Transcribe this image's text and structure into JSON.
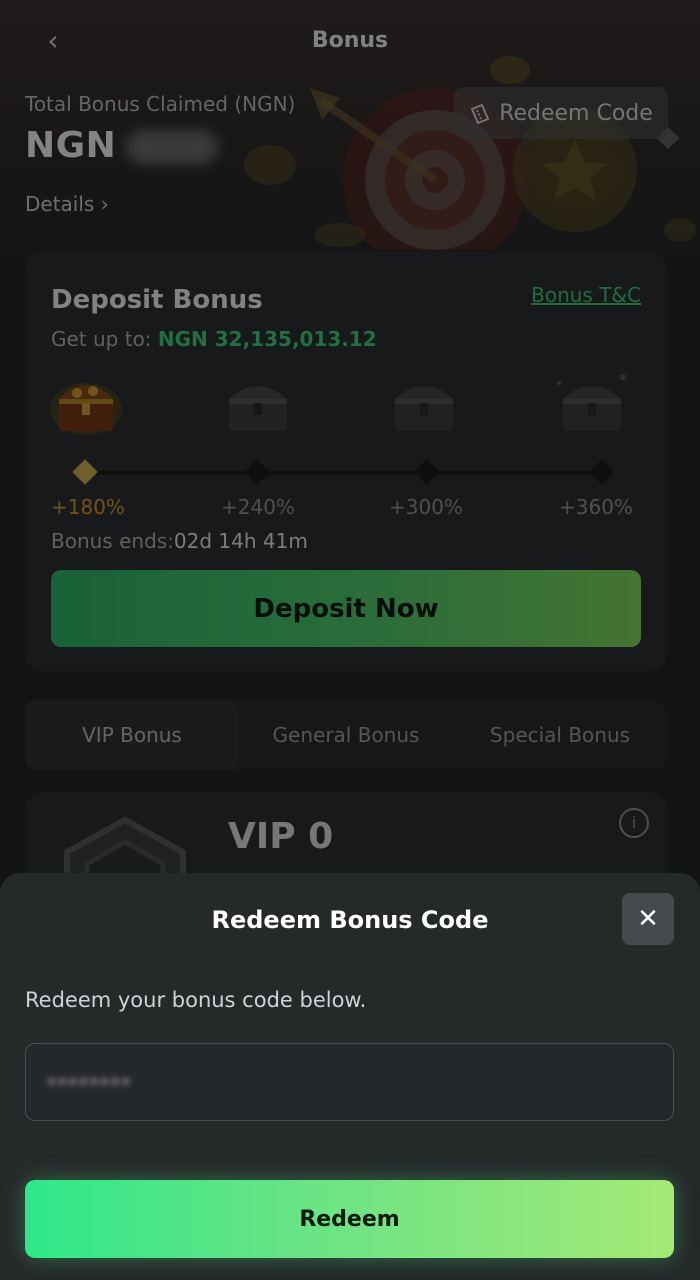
{
  "header": {
    "title": "Bonus",
    "back_icon": "chevron-left-icon"
  },
  "summary": {
    "total_label": "Total Bonus Claimed (NGN)",
    "total_currency": "NGN",
    "details_label": "Details",
    "redeem_code_label": "Redeem Code"
  },
  "deposit_bonus": {
    "title": "Deposit Bonus",
    "tc_label": "Bonus T&C",
    "get_up_to_label": "Get up to:",
    "get_up_to_amount": "NGN 32,135,013.12",
    "tiers": [
      {
        "percent": "+180%",
        "active": true
      },
      {
        "percent": "+240%",
        "active": false
      },
      {
        "percent": "+300%",
        "active": false
      },
      {
        "percent": "+360%",
        "active": false
      }
    ],
    "ends_label": "Bonus ends:",
    "ends_value": "02d 14h 41m",
    "cta_label": "Deposit Now"
  },
  "tabs": [
    {
      "label": "VIP Bonus",
      "active": true
    },
    {
      "label": "General Bonus",
      "active": false
    },
    {
      "label": "Special Bonus",
      "active": false
    }
  ],
  "vip": {
    "level": "VIP 0",
    "info_icon": "info-icon"
  },
  "modal": {
    "title": "Redeem Bonus Code",
    "close_icon": "close-icon",
    "description": "Redeem your bonus code below.",
    "code_value": "••••••••",
    "submit_label": "Redeem"
  },
  "colors": {
    "accent_green": "#3fcd7d",
    "button_gradient_start": "#2fe889",
    "button_gradient_end": "#a5e976",
    "active_tier": "#d69a2a"
  }
}
